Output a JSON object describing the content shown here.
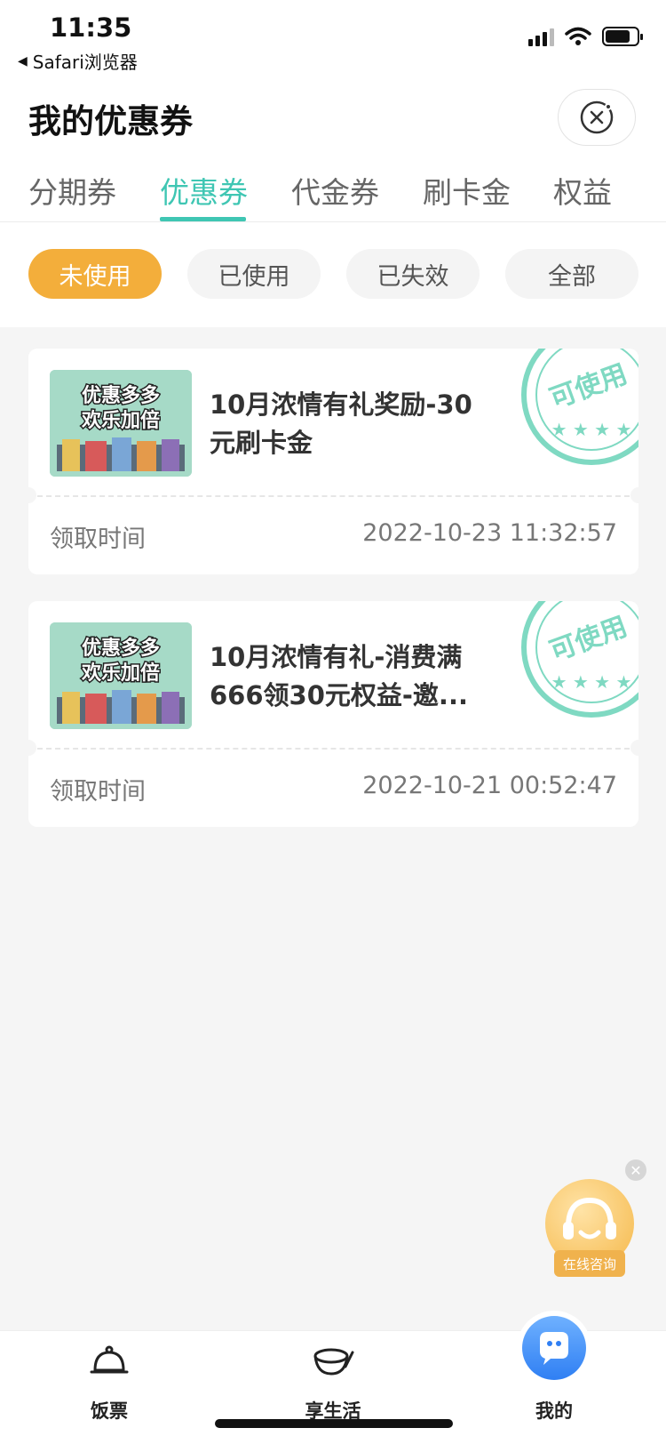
{
  "status_bar": {
    "time": "11:35",
    "back_label": "Safari浏览器"
  },
  "header": {
    "title": "我的优惠券"
  },
  "tabs": [
    {
      "label": "分期券",
      "active": false
    },
    {
      "label": "优惠券",
      "active": true
    },
    {
      "label": "代金券",
      "active": false
    },
    {
      "label": "刷卡金",
      "active": false
    },
    {
      "label": "权益",
      "active": false
    }
  ],
  "filters": [
    {
      "label": "未使用",
      "active": true
    },
    {
      "label": "已使用",
      "active": false
    },
    {
      "label": "已失效",
      "active": false
    },
    {
      "label": "全部",
      "active": false
    }
  ],
  "coupons": [
    {
      "thumb_line1": "优惠多多",
      "thumb_line2": "欢乐加倍",
      "title": "10月浓情有礼奖励-30元刷卡金",
      "time_label": "领取时间",
      "time": "2022-10-23 11:32:57",
      "stamp_text": "可使用"
    },
    {
      "thumb_line1": "优惠多多",
      "thumb_line2": "欢乐加倍",
      "title": "10月浓情有礼-消费满666领30元权益-邀...",
      "time_label": "领取时间",
      "time": "2022-10-21 00:52:47",
      "stamp_text": "可使用"
    }
  ],
  "consult": {
    "label": "在线咨询"
  },
  "bottom_nav": [
    {
      "label": "饭票",
      "icon": "cloche-icon"
    },
    {
      "label": "享生活",
      "icon": "bowl-icon"
    },
    {
      "label": "我的",
      "icon": "chat-face-icon"
    }
  ],
  "colors": {
    "accent": "#3fc6b3",
    "chip_active": "#f3ae3b",
    "stamp": "#7fd9c2"
  }
}
